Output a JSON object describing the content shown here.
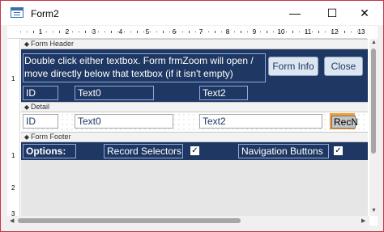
{
  "window": {
    "title": "Form2",
    "minimize_glyph": "—",
    "maximize_glyph": "☐",
    "close_glyph": "✕"
  },
  "ruler": {
    "h_numbers": [
      "1",
      "2",
      "3",
      "4",
      "5",
      "6",
      "7",
      "8",
      "9",
      "10",
      "11",
      "12",
      "13"
    ],
    "v_numbers": [
      "1",
      "1",
      "2",
      "3"
    ]
  },
  "sections": {
    "form_header": "Form Header",
    "detail": "Detail",
    "form_footer": "Form Footer",
    "arrow_glyph": "◆"
  },
  "header": {
    "line1": "Double click either textbox. Form frmZoom will open /",
    "line2": "move directly below that textbox (if it isn't empty)",
    "form_info_button": "Form Info",
    "close_button": "Close",
    "labels": [
      "ID",
      "Text0",
      "Text2"
    ]
  },
  "detail": {
    "id_field": "ID",
    "text0_field": "Text0",
    "text2_field": "Text2",
    "record_nav_control": "RecN"
  },
  "footer": {
    "options_label": "Options:",
    "record_selectors_label": "Record Selectors",
    "record_selectors_checked": true,
    "navigation_buttons_label": "Navigation Buttons",
    "navigation_buttons_checked": true,
    "check_glyph": "✓"
  },
  "scroll": {
    "up": "▲",
    "down": "▼",
    "left": "◀",
    "right": "▶"
  },
  "colors": {
    "navy": "#1f3863",
    "window_border": "#c8334a",
    "selection_orange": "#f0a030"
  }
}
